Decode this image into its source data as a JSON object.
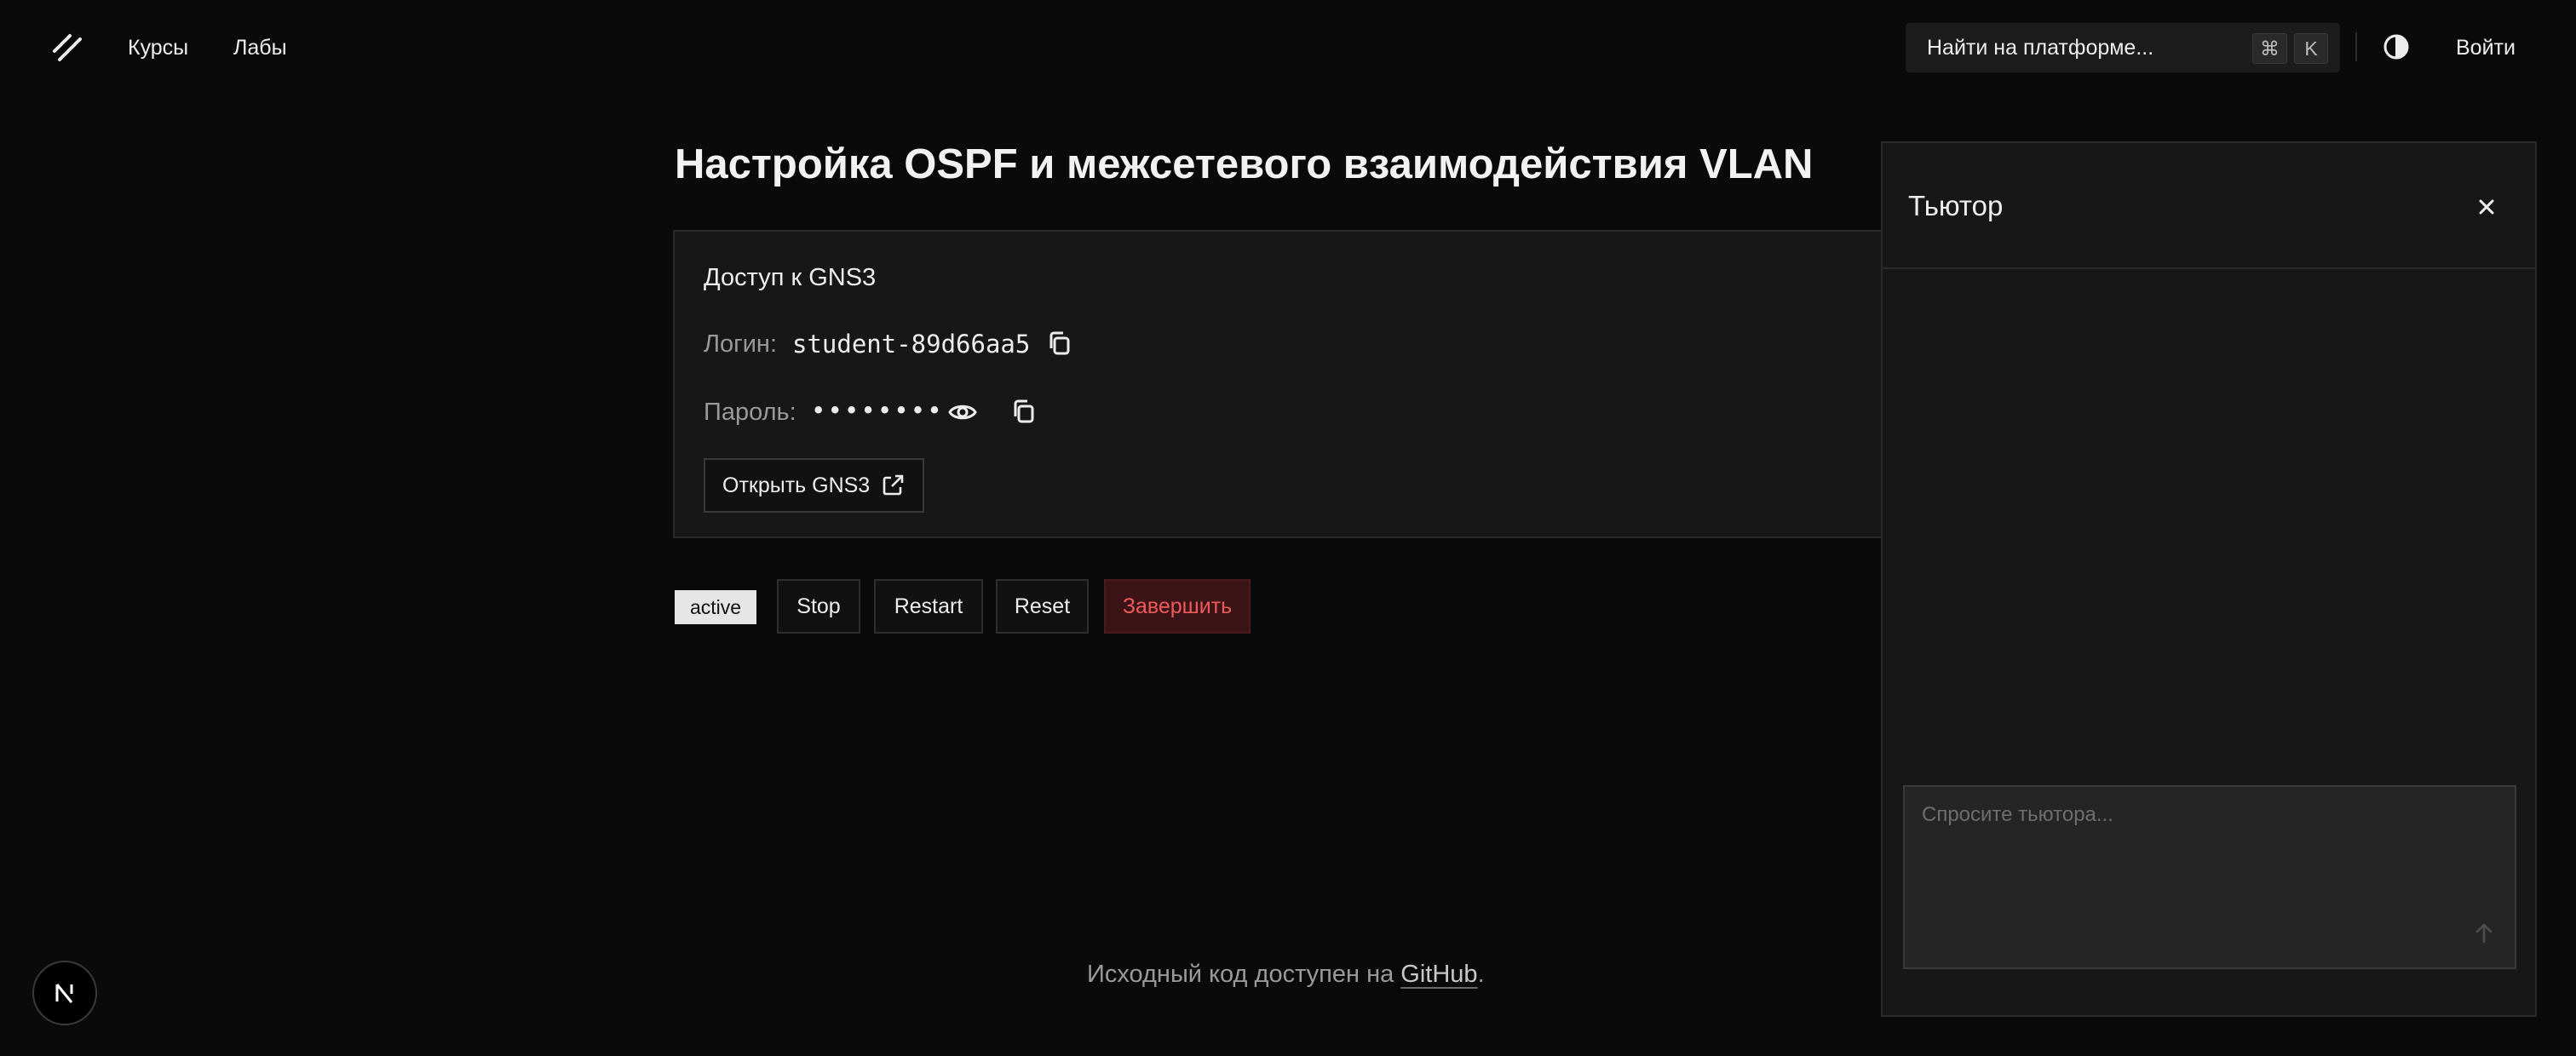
{
  "header": {
    "nav": [
      {
        "label": "Курсы"
      },
      {
        "label": "Лабы"
      }
    ],
    "search": {
      "placeholder": "Найти на платформе...",
      "shortcut_mod": "⌘",
      "shortcut_key": "K"
    },
    "login_label": "Войти"
  },
  "main": {
    "title": "Настройка OSPF и межсетевого взаимодействия VLAN",
    "access_card": {
      "title": "Доступ к GNS3",
      "login_label": "Логин:",
      "login_value": "student-89d66aa5",
      "password_label": "Пароль:",
      "password_masked": "••••••••",
      "open_button": "Открыть GNS3"
    },
    "controls": {
      "status": "active",
      "stop": "Stop",
      "restart": "Restart",
      "reset": "Reset",
      "finish": "Завершить"
    }
  },
  "tutor": {
    "title": "Тьютор",
    "input_placeholder": "Спросите тьютора..."
  },
  "footer": {
    "text_before": "Исходный код доступен на ",
    "link": "GitHub",
    "text_after": "."
  },
  "colors": {
    "background": "#0a0a0a",
    "card": "#171717",
    "finish_text": "#ef5a5a",
    "finish_bg": "#3a1416"
  },
  "icons": [
    "logo-icon",
    "copy-icon",
    "eye-icon",
    "external-link-icon",
    "close-icon",
    "arrow-up-icon",
    "theme-toggle-icon",
    "next-logo-icon"
  ]
}
